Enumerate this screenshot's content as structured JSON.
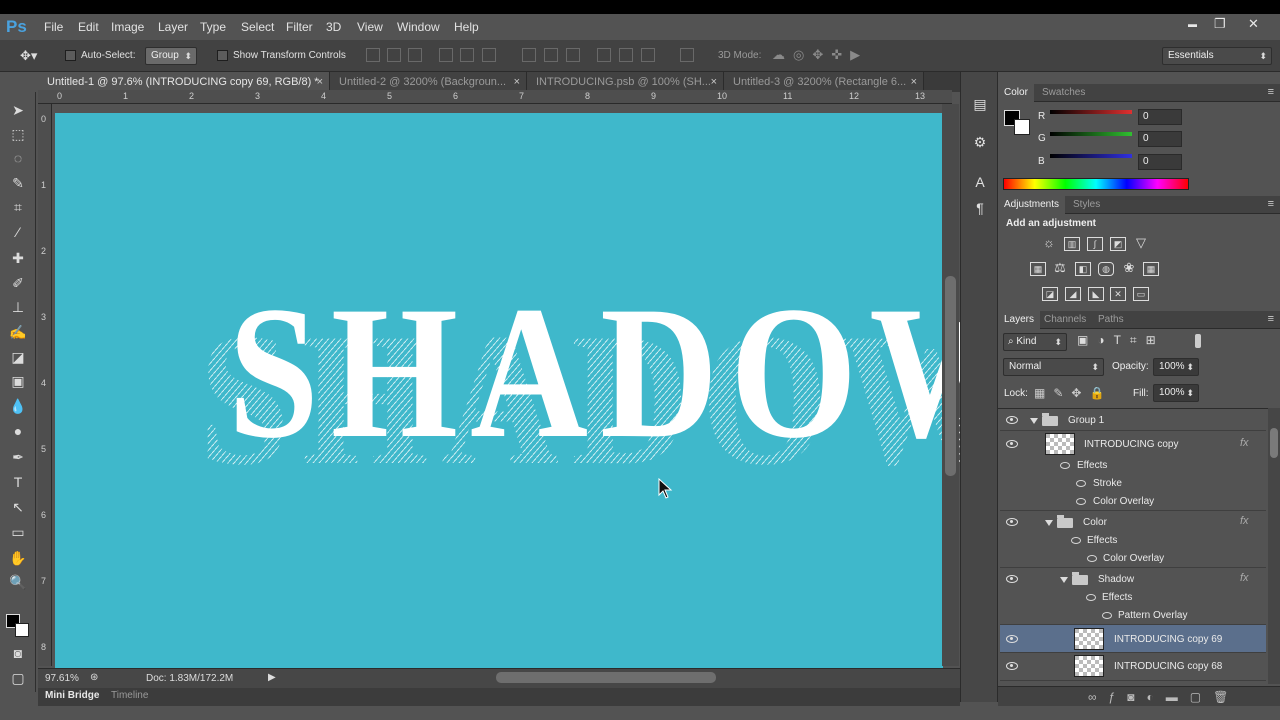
{
  "app": {
    "logo": "Ps"
  },
  "menu": [
    "File",
    "Edit",
    "Image",
    "Layer",
    "Type",
    "Select",
    "Filter",
    "3D",
    "View",
    "Window",
    "Help"
  ],
  "window_controls": {
    "minimize": "▬",
    "restore": "❐",
    "close": "✕"
  },
  "options": {
    "auto_select_label": "Auto-Select:",
    "auto_select_value": "Group",
    "show_transform_label": "Show Transform Controls",
    "mode_3d_label": "3D Mode:",
    "workspace": "Essentials"
  },
  "tabs": [
    {
      "label": "Untitled-1 @ 97.6% (INTRODUCING copy 69, RGB/8) *",
      "close": "×"
    },
    {
      "label": "Untitled-2 @ 3200% (Backgroun...",
      "close": "×"
    },
    {
      "label": "INTRODUCING.psb @ 100% (SH...",
      "close": "×"
    },
    {
      "label": "Untitled-3 @ 3200% (Rectangle 6...",
      "close": "×"
    }
  ],
  "ruler_top": [
    "0",
    "1",
    "2",
    "3",
    "4",
    "5",
    "6",
    "7",
    "8",
    "9",
    "10",
    "11",
    "12",
    "13"
  ],
  "ruler_left": [
    "0",
    "1",
    "2",
    "3",
    "4",
    "5",
    "6",
    "7",
    "8"
  ],
  "canvas": {
    "text": "SHADOW",
    "background": "#3fb8cb",
    "text_color": "#ffffff"
  },
  "status": {
    "zoom": "97.61%",
    "doc": "Doc: 1.83M/172.2M"
  },
  "bottom_tabs": [
    "Mini Bridge",
    "Timeline"
  ],
  "color_panel": {
    "tabs": [
      "Color",
      "Swatches"
    ],
    "channels": [
      {
        "label": "R",
        "value": "0",
        "color": "#e03030"
      },
      {
        "label": "G",
        "value": "0",
        "color": "#30c030"
      },
      {
        "label": "B",
        "value": "0",
        "color": "#3030e0"
      }
    ]
  },
  "adjustments_panel": {
    "tabs": [
      "Adjustments",
      "Styles"
    ],
    "heading": "Add an adjustment"
  },
  "layers_panel": {
    "tabs": [
      "Layers",
      "Channels",
      "Paths"
    ],
    "kind_label": "Kind",
    "blend_mode": "Normal",
    "opacity_label": "Opacity:",
    "opacity_value": "100%",
    "lock_label": "Lock:",
    "fill_label": "Fill:",
    "fill_value": "100%",
    "rows": [
      {
        "name": "Group 1"
      },
      {
        "name": "INTRODUCING copy"
      },
      {
        "name": "Effects"
      },
      {
        "name": "Stroke"
      },
      {
        "name": "Color Overlay"
      },
      {
        "name": "Color"
      },
      {
        "name": "Effects"
      },
      {
        "name": "Color Overlay"
      },
      {
        "name": "Shadow"
      },
      {
        "name": "Effects"
      },
      {
        "name": "Pattern Overlay"
      },
      {
        "name": "INTRODUCING copy 69"
      },
      {
        "name": "INTRODUCING copy 68"
      }
    ],
    "fx_label": "fx"
  },
  "colors": {
    "accent_selected_row": "#5b6f8c",
    "panel_bg": "#535353",
    "dark_bg": "#424242"
  }
}
